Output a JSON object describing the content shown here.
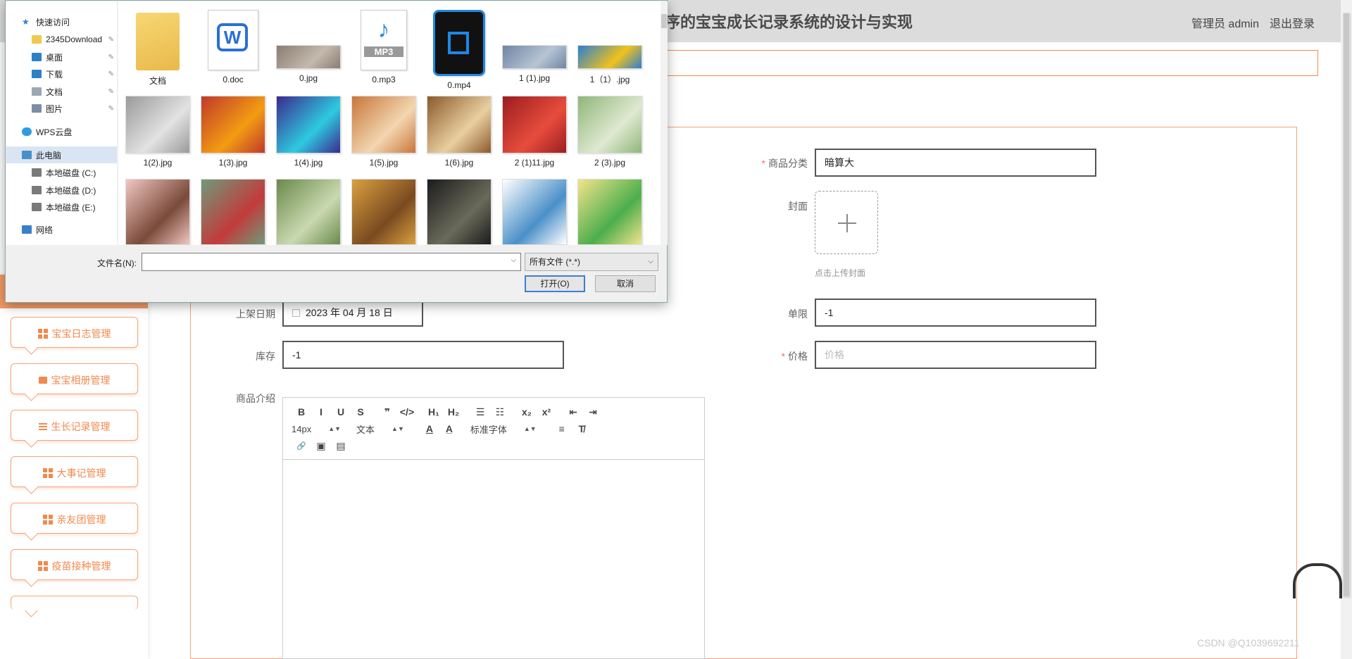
{
  "header": {
    "title": "序的宝宝成长记录系统的设计与实现",
    "user_label": "管理员 admin",
    "logout_label": "退出登录"
  },
  "sidebar": {
    "items": [
      {
        "label": "宝宝日志管理"
      },
      {
        "label": "宝宝相册管理"
      },
      {
        "label": "生长记录管理"
      },
      {
        "label": "大事记管理"
      },
      {
        "label": "亲友团管理"
      },
      {
        "label": "疫苗接种管理"
      }
    ]
  },
  "form": {
    "category_label": "商品分类",
    "category_value": "暗算大",
    "cover_label": "封面",
    "upload_tip": "点击上传封面",
    "date_label": "上架日期",
    "date_value": "2023 年 04 月 18 日",
    "limit_label": "单限",
    "limit_value": "-1",
    "stock_label": "库存",
    "stock_value": "-1",
    "price_label": "价格",
    "price_placeholder": "价格",
    "intro_label": "商品介绍"
  },
  "editor": {
    "font_size": "14px",
    "block_type": "文本",
    "font_family": "标准字体",
    "row1": [
      "B",
      "I",
      "U",
      "S",
      "❞",
      "</>",
      "H₁",
      "H₂",
      "☰",
      "☷",
      "x₂",
      "x²",
      "⇤",
      "⇥"
    ],
    "row2_extra": [
      "A",
      "A̲",
      "≡",
      "T̸"
    ],
    "row3": [
      "🔗",
      "▣",
      "▤"
    ]
  },
  "dialog": {
    "nav": [
      {
        "label": "快速访问",
        "icon": "star-icon",
        "pin": false
      },
      {
        "label": "2345Download",
        "icon": "folder-icon",
        "pin": true
      },
      {
        "label": "桌面",
        "icon": "desktop-icon",
        "pin": true
      },
      {
        "label": "下载",
        "icon": "download-icon",
        "pin": true
      },
      {
        "label": "文档",
        "icon": "document-icon",
        "pin": true
      },
      {
        "label": "图片",
        "icon": "picture-icon",
        "pin": true
      },
      {
        "label": "WPS云盘",
        "icon": "cloud-icon",
        "pin": false
      },
      {
        "label": "此电脑",
        "icon": "computer-icon",
        "pin": false
      },
      {
        "label": "本地磁盘 (C:)",
        "icon": "drive-icon",
        "pin": false
      },
      {
        "label": "本地磁盘 (D:)",
        "icon": "drive-icon",
        "pin": false
      },
      {
        "label": "本地磁盘 (E:)",
        "icon": "drive-icon",
        "pin": false
      },
      {
        "label": "网络",
        "icon": "network-icon",
        "pin": false
      }
    ],
    "files": [
      {
        "name": "文档",
        "kind": "folder",
        "colors": [
          "#f7d774",
          "#e9b94a"
        ]
      },
      {
        "name": "0.doc",
        "kind": "doc",
        "colors": [
          "#ffffff",
          "#2b6fd6"
        ]
      },
      {
        "name": "0.jpg",
        "kind": "image",
        "colors": [
          "#8a7d72",
          "#c4b9ad"
        ]
      },
      {
        "name": "0.mp3",
        "kind": "mp3",
        "colors": [
          "#ffffff",
          "#2f8fd8"
        ]
      },
      {
        "name": "0.mp4",
        "kind": "mp4",
        "colors": [
          "#111111",
          "#1e88e5"
        ]
      },
      {
        "name": "1 (1).jpg",
        "kind": "image",
        "colors": [
          "#6f86a3",
          "#b7c4d4"
        ]
      },
      {
        "name": "1（1）.jpg",
        "kind": "image",
        "colors": [
          "#2c7fd1",
          "#f1c21b"
        ]
      },
      {
        "name": "1(2).jpg",
        "kind": "image",
        "colors": [
          "#9a9a9a",
          "#e2e2e2"
        ]
      },
      {
        "name": "1(3).jpg",
        "kind": "image",
        "colors": [
          "#c0392b",
          "#f39c12"
        ]
      },
      {
        "name": "1(4).jpg",
        "kind": "image",
        "colors": [
          "#3b2a8f",
          "#2ecae0"
        ]
      },
      {
        "name": "1(5).jpg",
        "kind": "image",
        "colors": [
          "#c8763a",
          "#f3d6b0"
        ]
      },
      {
        "name": "1(6).jpg",
        "kind": "image",
        "colors": [
          "#8b5a2b",
          "#e9cfa0"
        ]
      },
      {
        "name": "2 (1)11.jpg",
        "kind": "image",
        "colors": [
          "#9b1d20",
          "#e74c3c"
        ]
      },
      {
        "name": "2 (3).jpg",
        "kind": "image",
        "colors": [
          "#8fb67a",
          "#dfe9d0"
        ]
      },
      {
        "name": "",
        "kind": "image",
        "colors": [
          "#f0c7c0",
          "#7a4a3a"
        ]
      },
      {
        "name": "",
        "kind": "image",
        "colors": [
          "#6f9a7a",
          "#c23b3b"
        ]
      },
      {
        "name": "",
        "kind": "image",
        "colors": [
          "#6a8a4a",
          "#c9d8b0"
        ]
      },
      {
        "name": "",
        "kind": "image",
        "colors": [
          "#d9a040",
          "#7a4a20"
        ]
      },
      {
        "name": "",
        "kind": "image",
        "colors": [
          "#1c1c1c",
          "#6a6a5a"
        ]
      },
      {
        "name": "",
        "kind": "image",
        "colors": [
          "#ffffff",
          "#4a90c8"
        ]
      },
      {
        "name": "",
        "kind": "image",
        "colors": [
          "#f2e48c",
          "#4cae4c"
        ]
      }
    ],
    "filename_label": "文件名(N):",
    "filetype_value": "所有文件 (*.*)",
    "open_label": "打开(O)",
    "cancel_label": "取消"
  },
  "watermark": "CSDN @Q1039692211"
}
